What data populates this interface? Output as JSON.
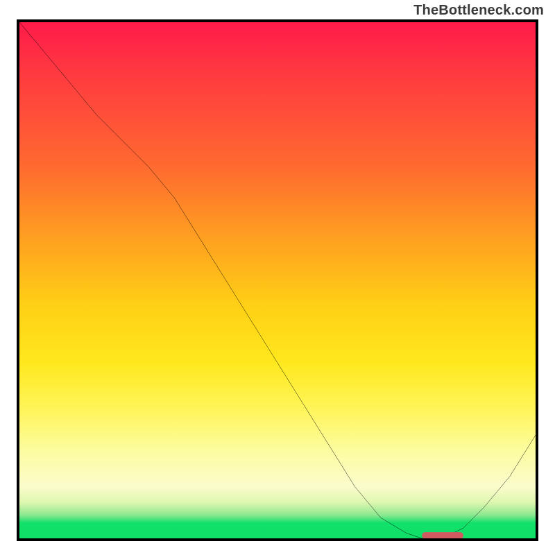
{
  "watermark": "TheBottleneck.com",
  "chart_data": {
    "type": "line",
    "title": "",
    "xlabel": "",
    "ylabel": "",
    "xlim": [
      0,
      100
    ],
    "ylim": [
      0,
      100
    ],
    "series": [
      {
        "name": "bottleneck-curve",
        "x": [
          0,
          5,
          10,
          15,
          20,
          25,
          30,
          35,
          40,
          45,
          50,
          55,
          60,
          65,
          70,
          75,
          78,
          82,
          86,
          90,
          95,
          100
        ],
        "y": [
          100,
          94,
          88,
          82,
          77,
          72,
          66,
          58,
          50,
          42,
          34,
          26,
          18,
          10,
          4,
          1,
          0,
          0,
          2,
          6,
          12,
          20
        ]
      }
    ],
    "background_gradient": {
      "stops": [
        {
          "pos": 0.0,
          "color": "#ff1a4a"
        },
        {
          "pos": 0.1,
          "color": "#ff3a40"
        },
        {
          "pos": 0.28,
          "color": "#ff6a30"
        },
        {
          "pos": 0.42,
          "color": "#ffa020"
        },
        {
          "pos": 0.55,
          "color": "#ffd015"
        },
        {
          "pos": 0.66,
          "color": "#ffe81e"
        },
        {
          "pos": 0.75,
          "color": "#fff55a"
        },
        {
          "pos": 0.83,
          "color": "#fbfca0"
        },
        {
          "pos": 0.9,
          "color": "#fbfccc"
        },
        {
          "pos": 0.93,
          "color": "#dff7b0"
        },
        {
          "pos": 0.955,
          "color": "#8ce890"
        },
        {
          "pos": 0.97,
          "color": "#11e06a"
        },
        {
          "pos": 1.0,
          "color": "#10df68"
        }
      ]
    },
    "marker": {
      "name": "optimal-range-marker",
      "x_start": 78,
      "x_end": 86,
      "y": 0.5,
      "color": "#cf5a5f"
    }
  }
}
